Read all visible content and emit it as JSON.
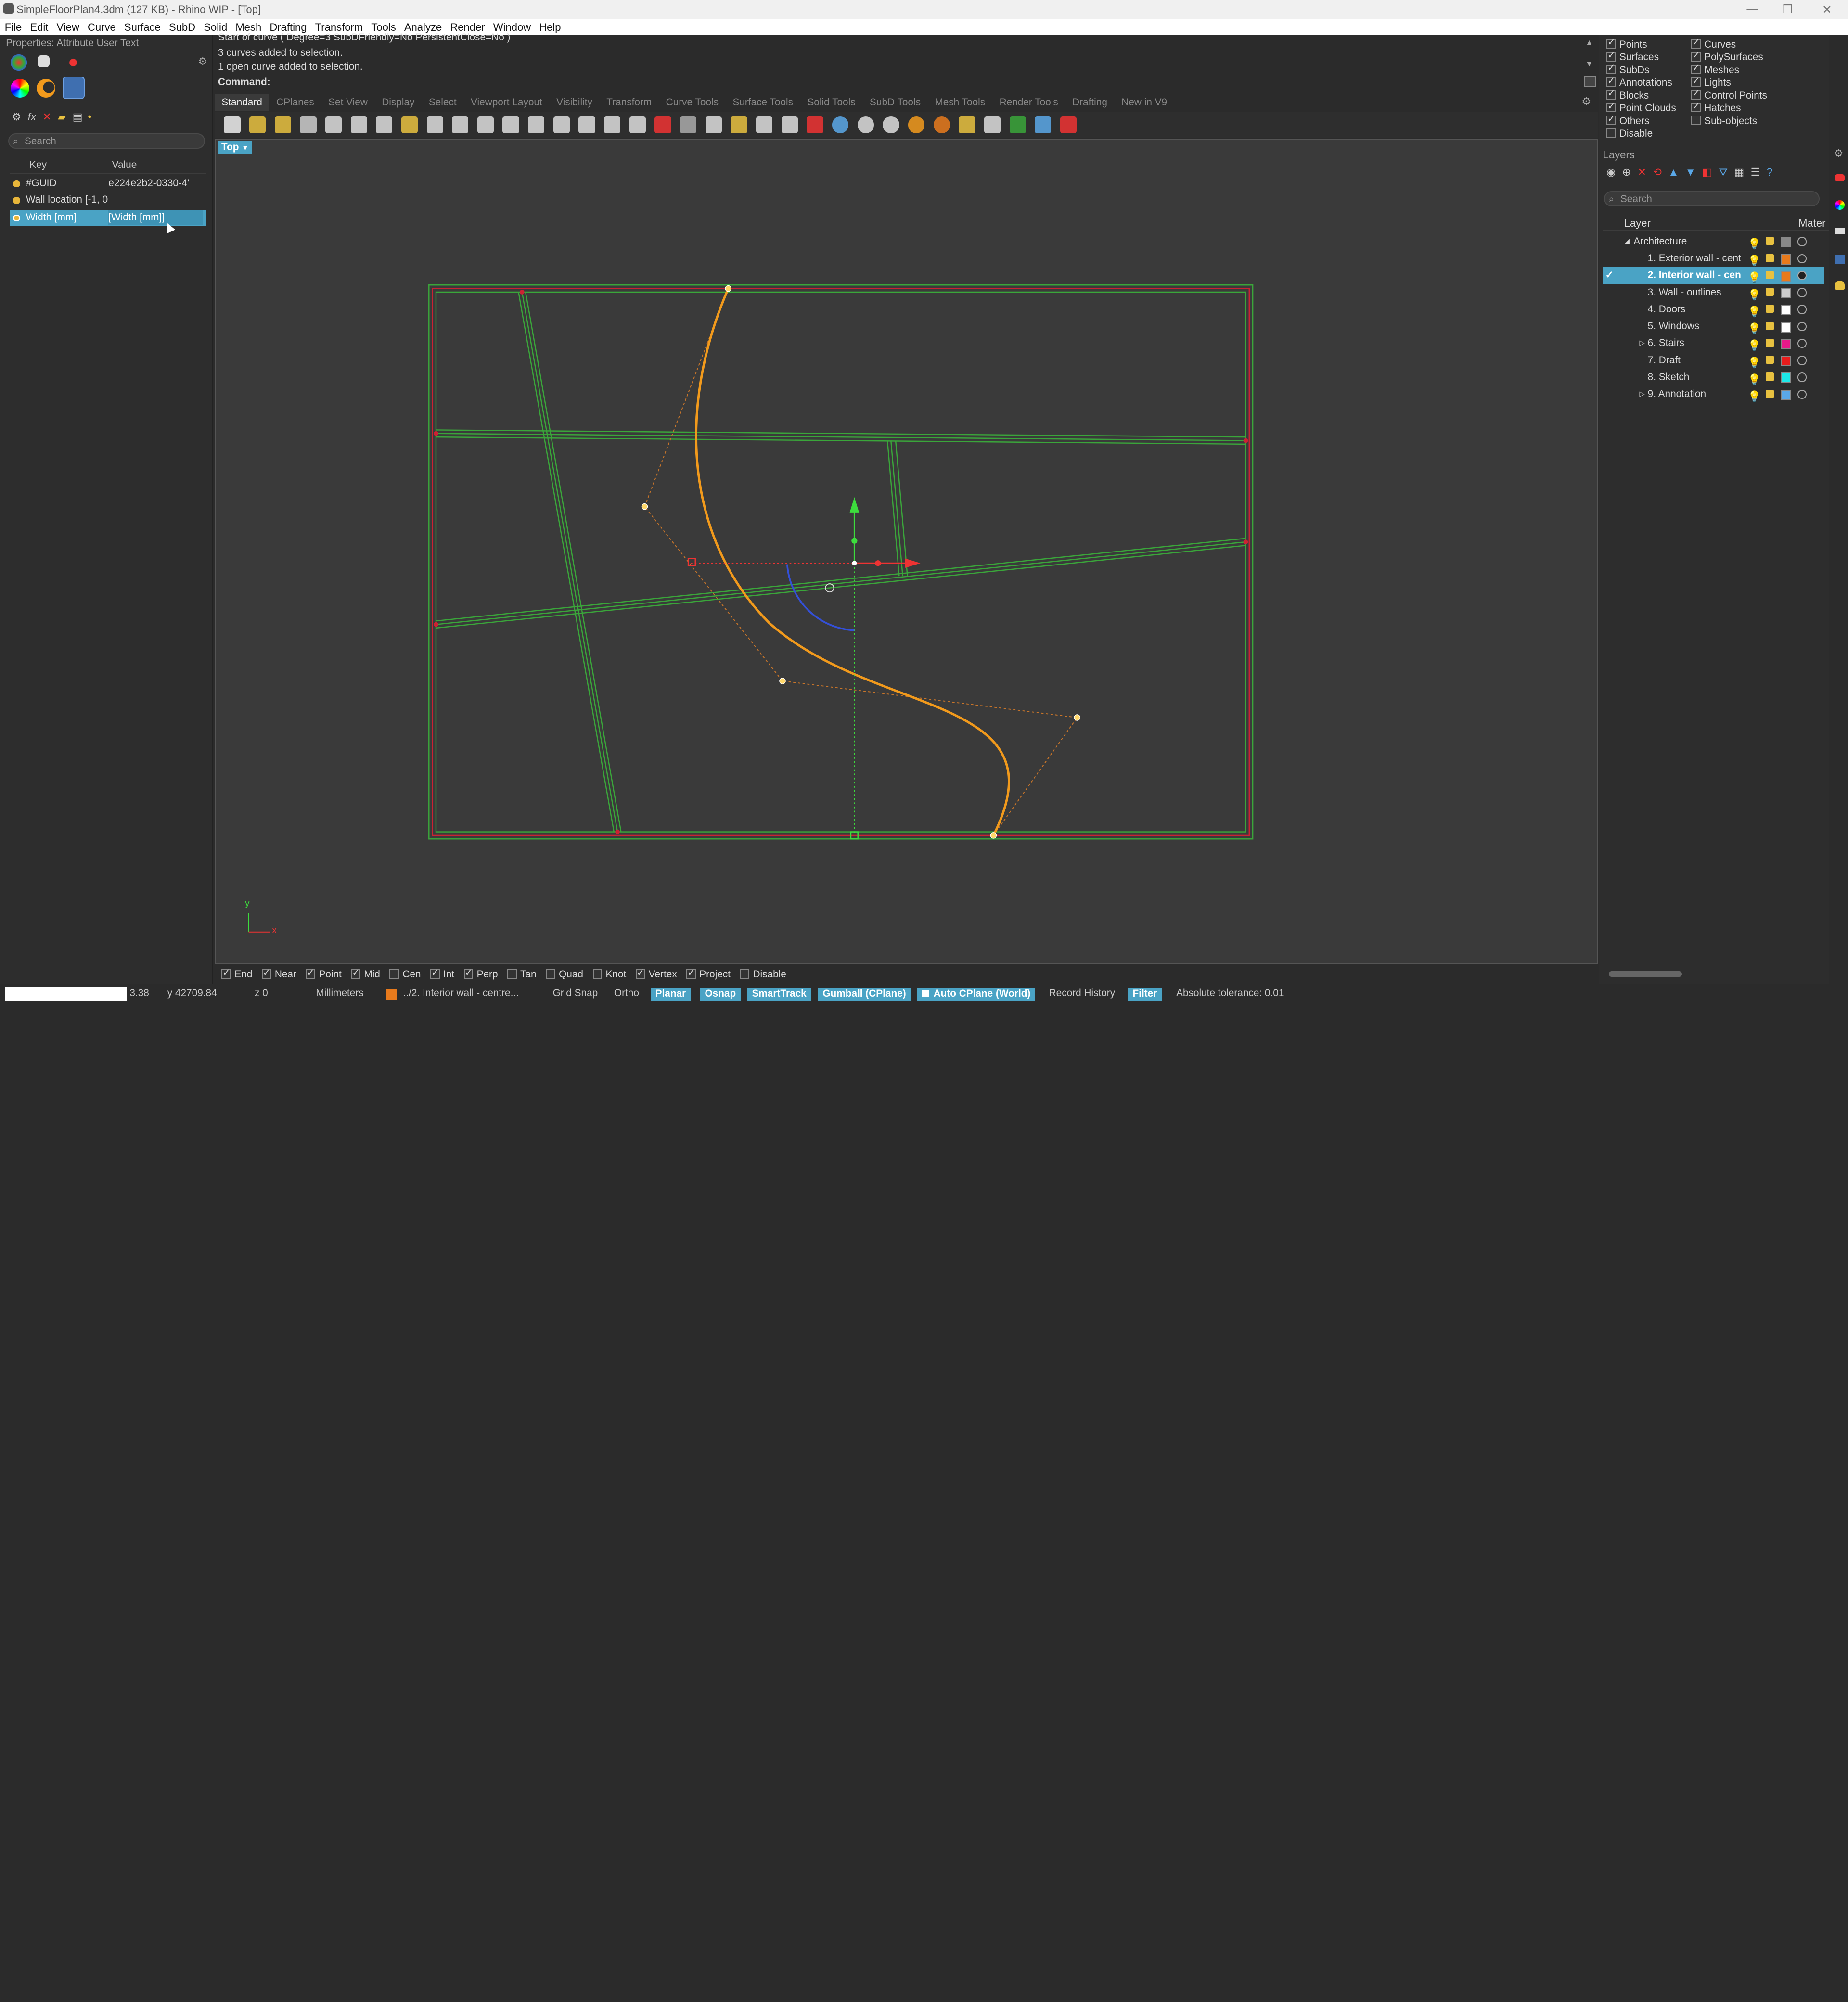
{
  "window": {
    "title": "SimpleFloorPlan4.3dm (127 KB) - Rhino WIP - [Top]"
  },
  "menu": [
    "File",
    "Edit",
    "View",
    "Curve",
    "Surface",
    "SubD",
    "Solid",
    "Mesh",
    "Drafting",
    "Transform",
    "Tools",
    "Analyze",
    "Render",
    "Window",
    "Help"
  ],
  "left_panel": {
    "title": "Properties: Attribute User Text",
    "search_placeholder": "Search",
    "columns": {
      "key": "Key",
      "value": "Value"
    },
    "rows": [
      {
        "key": "#GUID",
        "value": "e224e2b2-0330-4'"
      },
      {
        "key": "Wall location [-1, 0",
        "value": ""
      },
      {
        "key": "Width [mm]",
        "value": "[Width [mm]]"
      }
    ],
    "selected_row": 2
  },
  "command": {
    "history": [
      "Start of curve ( Degree=3  SubDFriendly=No  PersistentClose=No )",
      "3 curves added to selection.",
      "1 open curve added to selection."
    ],
    "prompt": "Command:"
  },
  "tabs": [
    "Standard",
    "CPlanes",
    "Set View",
    "Display",
    "Select",
    "Viewport Layout",
    "Visibility",
    "Transform",
    "Curve Tools",
    "Surface Tools",
    "Solid Tools",
    "SubD Tools",
    "Mesh Tools",
    "Render Tools",
    "Drafting",
    "New in V9"
  ],
  "active_tab": "Standard",
  "viewport": {
    "name": "Top",
    "axis_y": "y",
    "axis_x": "x"
  },
  "osnaps": [
    {
      "label": "End",
      "on": true
    },
    {
      "label": "Near",
      "on": true
    },
    {
      "label": "Point",
      "on": true
    },
    {
      "label": "Mid",
      "on": true
    },
    {
      "label": "Cen",
      "on": false
    },
    {
      "label": "Int",
      "on": true
    },
    {
      "label": "Perp",
      "on": true
    },
    {
      "label": "Tan",
      "on": false
    },
    {
      "label": "Quad",
      "on": false
    },
    {
      "label": "Knot",
      "on": false
    },
    {
      "label": "Vertex",
      "on": true
    },
    {
      "label": "Project",
      "on": true
    },
    {
      "label": "Disable",
      "on": false
    }
  ],
  "status": {
    "x": "3.38",
    "y": "y 42709.84",
    "z": "z 0",
    "units": "Millimeters",
    "layer": "../2. Interior wall - centre...",
    "grid_snap": "Grid Snap",
    "ortho": "Ortho",
    "planar": "Planar",
    "osnap": "Osnap",
    "smarttrack": "SmartTrack",
    "gumball": "Gumball (CPlane)",
    "auto_cplane": "Auto CPlane (World)",
    "record_history": "Record History",
    "filter": "Filter",
    "tolerance": "Absolute tolerance: 0.01",
    "layer_color": "#e87a1c"
  },
  "filters": {
    "left": [
      {
        "label": "Points",
        "on": true
      },
      {
        "label": "Surfaces",
        "on": true
      },
      {
        "label": "SubDs",
        "on": true
      },
      {
        "label": "Annotations",
        "on": true
      },
      {
        "label": "Blocks",
        "on": true
      },
      {
        "label": "Point Clouds",
        "on": true
      },
      {
        "label": "Others",
        "on": true
      },
      {
        "label": "Disable",
        "on": false
      }
    ],
    "right": [
      {
        "label": "Curves",
        "on": true
      },
      {
        "label": "PolySurfaces",
        "on": true
      },
      {
        "label": "Meshes",
        "on": true
      },
      {
        "label": "Lights",
        "on": true
      },
      {
        "label": "Control Points",
        "on": true
      },
      {
        "label": "Hatches",
        "on": true
      },
      {
        "label": "Sub-objects",
        "on": false
      }
    ]
  },
  "layers_panel": {
    "title": "Layers",
    "search_placeholder": "Search",
    "col_layer": "Layer",
    "col_material": "Mater",
    "layers": [
      {
        "name": "Architecture",
        "color": "#888888",
        "indent": 0,
        "expand": "◢",
        "current": false
      },
      {
        "name": "1. Exterior wall - cent",
        "color": "#e87a1c",
        "indent": 1,
        "expand": "",
        "current": false
      },
      {
        "name": "2. Interior wall - cen",
        "color": "#e87a1c",
        "indent": 1,
        "expand": "",
        "current": true
      },
      {
        "name": "3. Wall - outlines",
        "color": "#cccccc",
        "indent": 1,
        "expand": "",
        "current": false
      },
      {
        "name": "4. Doors",
        "color": "#ffffff",
        "indent": 1,
        "expand": "",
        "current": false
      },
      {
        "name": "5. Windows",
        "color": "#ffffff",
        "indent": 1,
        "expand": "",
        "current": false
      },
      {
        "name": "6. Stairs",
        "color": "#e8198a",
        "indent": 1,
        "expand": "▷",
        "current": false
      },
      {
        "name": "7. Draft",
        "color": "#e81c1c",
        "indent": 1,
        "expand": "",
        "current": false
      },
      {
        "name": "8. Sketch",
        "color": "#1ce8e8",
        "indent": 1,
        "expand": "",
        "current": false
      },
      {
        "name": "9. Annotation",
        "color": "#5aa8e8",
        "indent": 1,
        "expand": "▷",
        "current": false
      }
    ]
  },
  "colors": {
    "accent": "#4aa3c5",
    "wall_green": "#3aa63a",
    "curve_orange": "#f29a1c"
  }
}
